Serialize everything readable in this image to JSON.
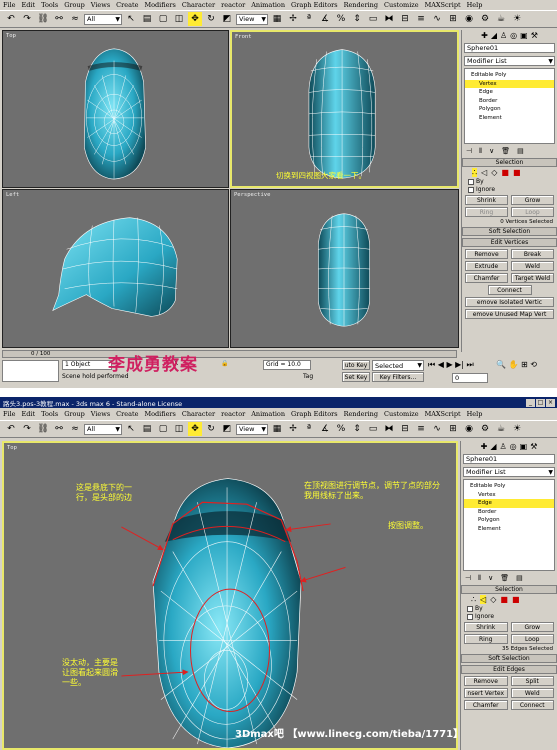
{
  "menu": [
    "File",
    "Edit",
    "Tools",
    "Group",
    "Views",
    "Create",
    "Modifiers",
    "Character",
    "reactor",
    "Animation",
    "Graph Editors",
    "Rendering",
    "Customize",
    "MAXScript",
    "Help"
  ],
  "toolbar": {
    "selection_filter": "All",
    "ref_coord": "View"
  },
  "top": {
    "viewports": {
      "top": "Top",
      "front": "Front",
      "left": "Left",
      "perspective": "Perspective"
    },
    "front_note": "切换到四视图大家看一下。",
    "panel": {
      "object_name": "Sphere01",
      "modifier_list": "Modifier List",
      "stack": [
        "Editable Poly",
        "Vertex",
        "Edge",
        "Border",
        "Polygon",
        "Element"
      ],
      "selected_stack": "Vertex",
      "selection_header": "Selection",
      "by": "By",
      "ignore": "Ignore",
      "shrink": "Shrink",
      "grow": "Grow",
      "ring": "Ring",
      "loop": "Loop",
      "sel_count": "0 Vertices Selected",
      "soft_selection": "Soft Selection",
      "edit_vertices": "Edit Vertices",
      "remove": "Remove",
      "break": "Break",
      "extrude": "Extrude",
      "weld": "Weld",
      "chamfer": "Chamfer",
      "target_weld": "Target Weld",
      "connect": "Connect",
      "remove_isolated": "emove Isolated Vertic",
      "remove_unused": "emove Unused Map Vert"
    },
    "status": {
      "timeline": "0 / 100",
      "selected": "1 Object",
      "prompt": "Scene hold performed",
      "grid": "Grid = 10.0",
      "auto_key": "uto Key",
      "auto_key_val": "Selected",
      "set_key": "Set Key",
      "key_filters": "Key Filters...",
      "frame": "0",
      "tag": "Tag",
      "x_label": "X",
      "y_label": "Y"
    },
    "watermark": "李成勇教案"
  },
  "bottom": {
    "titlebar": "路头3.pos-3教程.max - 3ds max 6 - Stand-alone License",
    "viewport": "Top",
    "notes": {
      "left_top": "这是悬底下的一行，是头部的边",
      "right_top": "在顶视图进行调节点，调节了点的部分我用线标了出来。",
      "right_mid": "按图调整。",
      "left_bottom": "没太动，主要是让图看起来圆滑一些。"
    },
    "panel": {
      "object_name": "Sphere01",
      "modifier_list": "Modifier List",
      "stack": [
        "Editable Poly",
        "Vertex",
        "Edge",
        "Border",
        "Polygon",
        "Element"
      ],
      "selected_stack": "Edge",
      "selection_header": "Selection",
      "by": "By",
      "ignore": "Ignore",
      "shrink": "Shrink",
      "grow": "Grow",
      "ring": "Ring",
      "loop": "Loop",
      "sel_count": "35 Edges Selected",
      "soft_selection": "Soft Selection",
      "edit_edges": "Edit Edges",
      "remove": "Remove",
      "split": "Split",
      "insert_vertex": "nsert Vertex",
      "weld": "Weld",
      "chamfer": "Chamfer",
      "connect": "Connect"
    },
    "footer": "3Dmax吧 【www.linecg.com/tieba/1771】"
  },
  "colors": {
    "viewport_bg": "#6f6f6f",
    "mesh": "#3ab0c8",
    "mesh_dark": "#0e3f4c",
    "note": "#ffff33",
    "selection_highlight": "#ffeb33",
    "watermark": "#cf2060",
    "red_line": "#e02020"
  }
}
